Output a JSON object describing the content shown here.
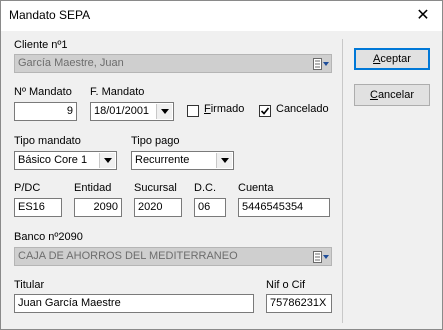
{
  "window": {
    "title": "Mandato SEPA",
    "close_glyph": "✕"
  },
  "cliente": {
    "label": "Cliente nº1",
    "value": "García Maestre, Juan"
  },
  "mandato": {
    "numero_label": "Nº Mandato",
    "numero_value": "9",
    "fecha_label": "F. Mandato",
    "fecha_value": "18/01/2001"
  },
  "firmado": {
    "label": "Firmado",
    "checked": false
  },
  "cancelado": {
    "label": "Cancelado",
    "checked": true
  },
  "tipo_mandato": {
    "label": "Tipo mandato",
    "value": "Básico Core 1"
  },
  "tipo_pago": {
    "label": "Tipo pago",
    "value": "Recurrente"
  },
  "cuenta": {
    "pdc_label": "P/DC",
    "pdc_value": "ES16",
    "entidad_label": "Entidad",
    "entidad_value": "2090",
    "sucursal_label": "Sucursal",
    "sucursal_value": "2020",
    "dc_label": "D.C.",
    "dc_value": "06",
    "cuenta_label": "Cuenta",
    "cuenta_value": "5446545354"
  },
  "banco": {
    "label": "Banco nº2090",
    "value": "CAJA DE AHORROS DEL MEDITERRANEO"
  },
  "titular": {
    "label": "Titular",
    "value": "Juan García Maestre"
  },
  "nif": {
    "label": "Nif o Cif",
    "value": "75786231X"
  },
  "buttons": {
    "accept": "Aceptar",
    "cancel": "Cancelar"
  },
  "icons": {
    "dropdown": "chevron-down-icon",
    "lookup": "lookup-list-icon",
    "checkmark": "checkmark-icon"
  },
  "colors": {
    "accent": "#0078d7",
    "disabled_bg": "#cfcfcf",
    "window_bg": "#f0f0f0"
  }
}
